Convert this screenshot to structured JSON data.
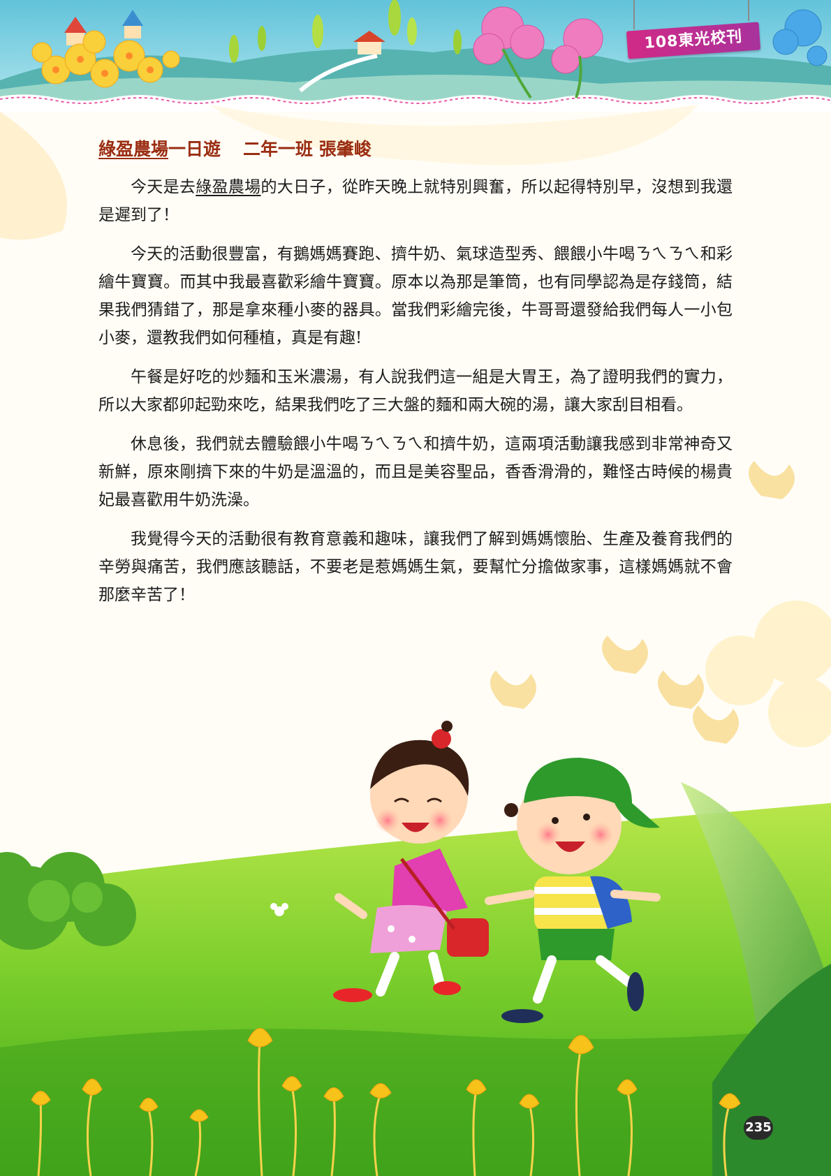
{
  "header": {
    "tag": "108東光校刊"
  },
  "article": {
    "title_farm": "綠盈農場",
    "title_rest": "一日遊",
    "title_author": "二年一班 張肇峻",
    "p1": {
      "a": "今天是去",
      "farm": "綠盈農場",
      "b": "的大日子，從昨天晚上就特別興奮，所以起得特別早，沒想到我還是遲到了！"
    },
    "p2": "今天的活動很豐富，有鵝媽媽賽跑、擠牛奶、氣球造型秀、餵餵小牛喝ㄋㄟㄋㄟ和彩繪牛寶寶。而其中我最喜歡彩繪牛寶寶。原本以為那是筆筒，也有同學認為是存錢筒，結果我們猜錯了，那是拿來種小麥的器具。當我們彩繪完後，牛哥哥還發給我們每人一小包小麥，還教我們如何種植，真是有趣!",
    "p3": "午餐是好吃的炒麵和玉米濃湯，有人說我們這一組是大胃王，為了證明我們的實力，所以大家都卯起勁來吃，結果我們吃了三大盤的麵和兩大碗的湯，讓大家刮目相看。",
    "p4": "休息後，我們就去體驗餵小牛喝ㄋㄟㄋㄟ和擠牛奶，這兩項活動讓我感到非常神奇又新鮮，原來剛擠下來的牛奶是溫溫的，而且是美容聖品，香香滑滑的，難怪古時候的楊貴妃最喜歡用牛奶洗澡。",
    "p5": "我覺得今天的活動很有教育意義和趣味，讓我們了解到媽媽懷胎、生產及養育我們的辛勞與痛苦，我們應該聽話，不要老是惹媽媽生氣，要幫忙分擔做家事，這樣媽媽就不會那麼辛苦了！"
  },
  "footer": {
    "page_number": "235"
  },
  "illustration": {
    "sky_color": "#7fd0e2",
    "hill_color": "#5fb8b4",
    "grass_color": "#8fd43a",
    "flower_color": "#f7c21a",
    "girl_dress_color": "#e23fb0",
    "boy_cap_color": "#2f9a2c"
  }
}
